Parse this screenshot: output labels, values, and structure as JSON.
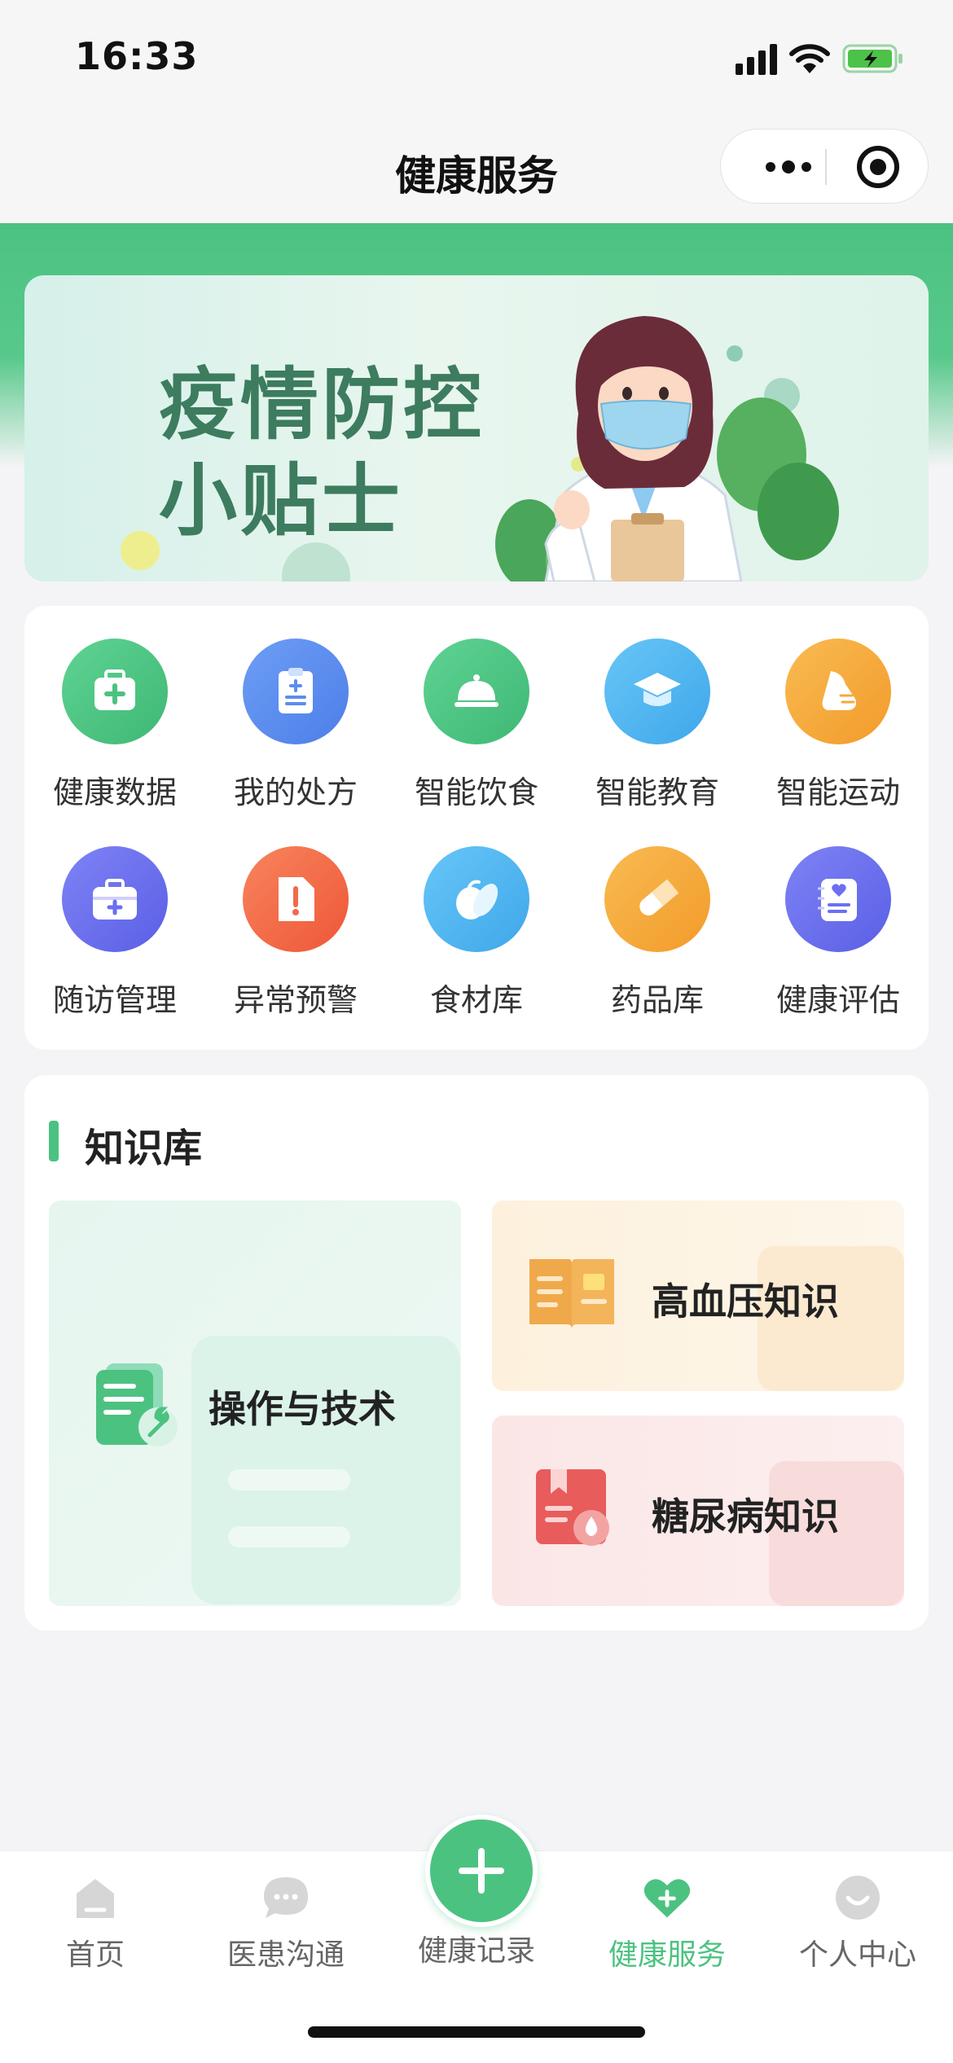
{
  "status_bar": {
    "time": "16:33"
  },
  "nav": {
    "title": "健康服务"
  },
  "banner": {
    "title": "疫情防控\n小贴士"
  },
  "services": [
    {
      "label": "健康数据",
      "color": "#4cc281",
      "icon": "medical-kit-icon"
    },
    {
      "label": "我的处方",
      "color": "#5b8def",
      "icon": "prescription-clipboard-icon"
    },
    {
      "label": "智能饮食",
      "color": "#4cc281",
      "icon": "food-cloche-icon"
    },
    {
      "label": "智能教育",
      "color": "#4fb3f0",
      "icon": "graduation-cap-icon"
    },
    {
      "label": "智能运动",
      "color": "#f5a93a",
      "icon": "sneaker-icon"
    },
    {
      "label": "随访管理",
      "color": "#6b6ff0",
      "icon": "briefcase-plus-icon"
    },
    {
      "label": "异常预警",
      "color": "#f26b4a",
      "icon": "alert-document-icon"
    },
    {
      "label": "食材库",
      "color": "#4fb3f0",
      "icon": "vegetables-icon"
    },
    {
      "label": "药品库",
      "color": "#f5a93a",
      "icon": "pill-icon"
    },
    {
      "label": "健康评估",
      "color": "#6b6ff0",
      "icon": "health-report-icon"
    }
  ],
  "knowledge": {
    "title": "知识库",
    "tiles": [
      {
        "label": "操作与技术",
        "icon": "document-wrench-icon",
        "color": "#4cc281"
      },
      {
        "label": "高血压知识",
        "icon": "open-book-icon",
        "color": "#f0a94a"
      },
      {
        "label": "糖尿病知识",
        "icon": "red-book-drop-icon",
        "color": "#e85c5c"
      }
    ]
  },
  "tabs": [
    {
      "label": "首页",
      "icon": "home-icon"
    },
    {
      "label": "医患沟通",
      "icon": "chat-bubble-icon"
    },
    {
      "label": "健康记录",
      "icon": "plus-icon"
    },
    {
      "label": "健康服务",
      "icon": "heart-plus-icon",
      "active": true
    },
    {
      "label": "个人中心",
      "icon": "profile-icon"
    }
  ],
  "colors": {
    "accent": "#4cc281",
    "inactive_tab": "#666666"
  }
}
